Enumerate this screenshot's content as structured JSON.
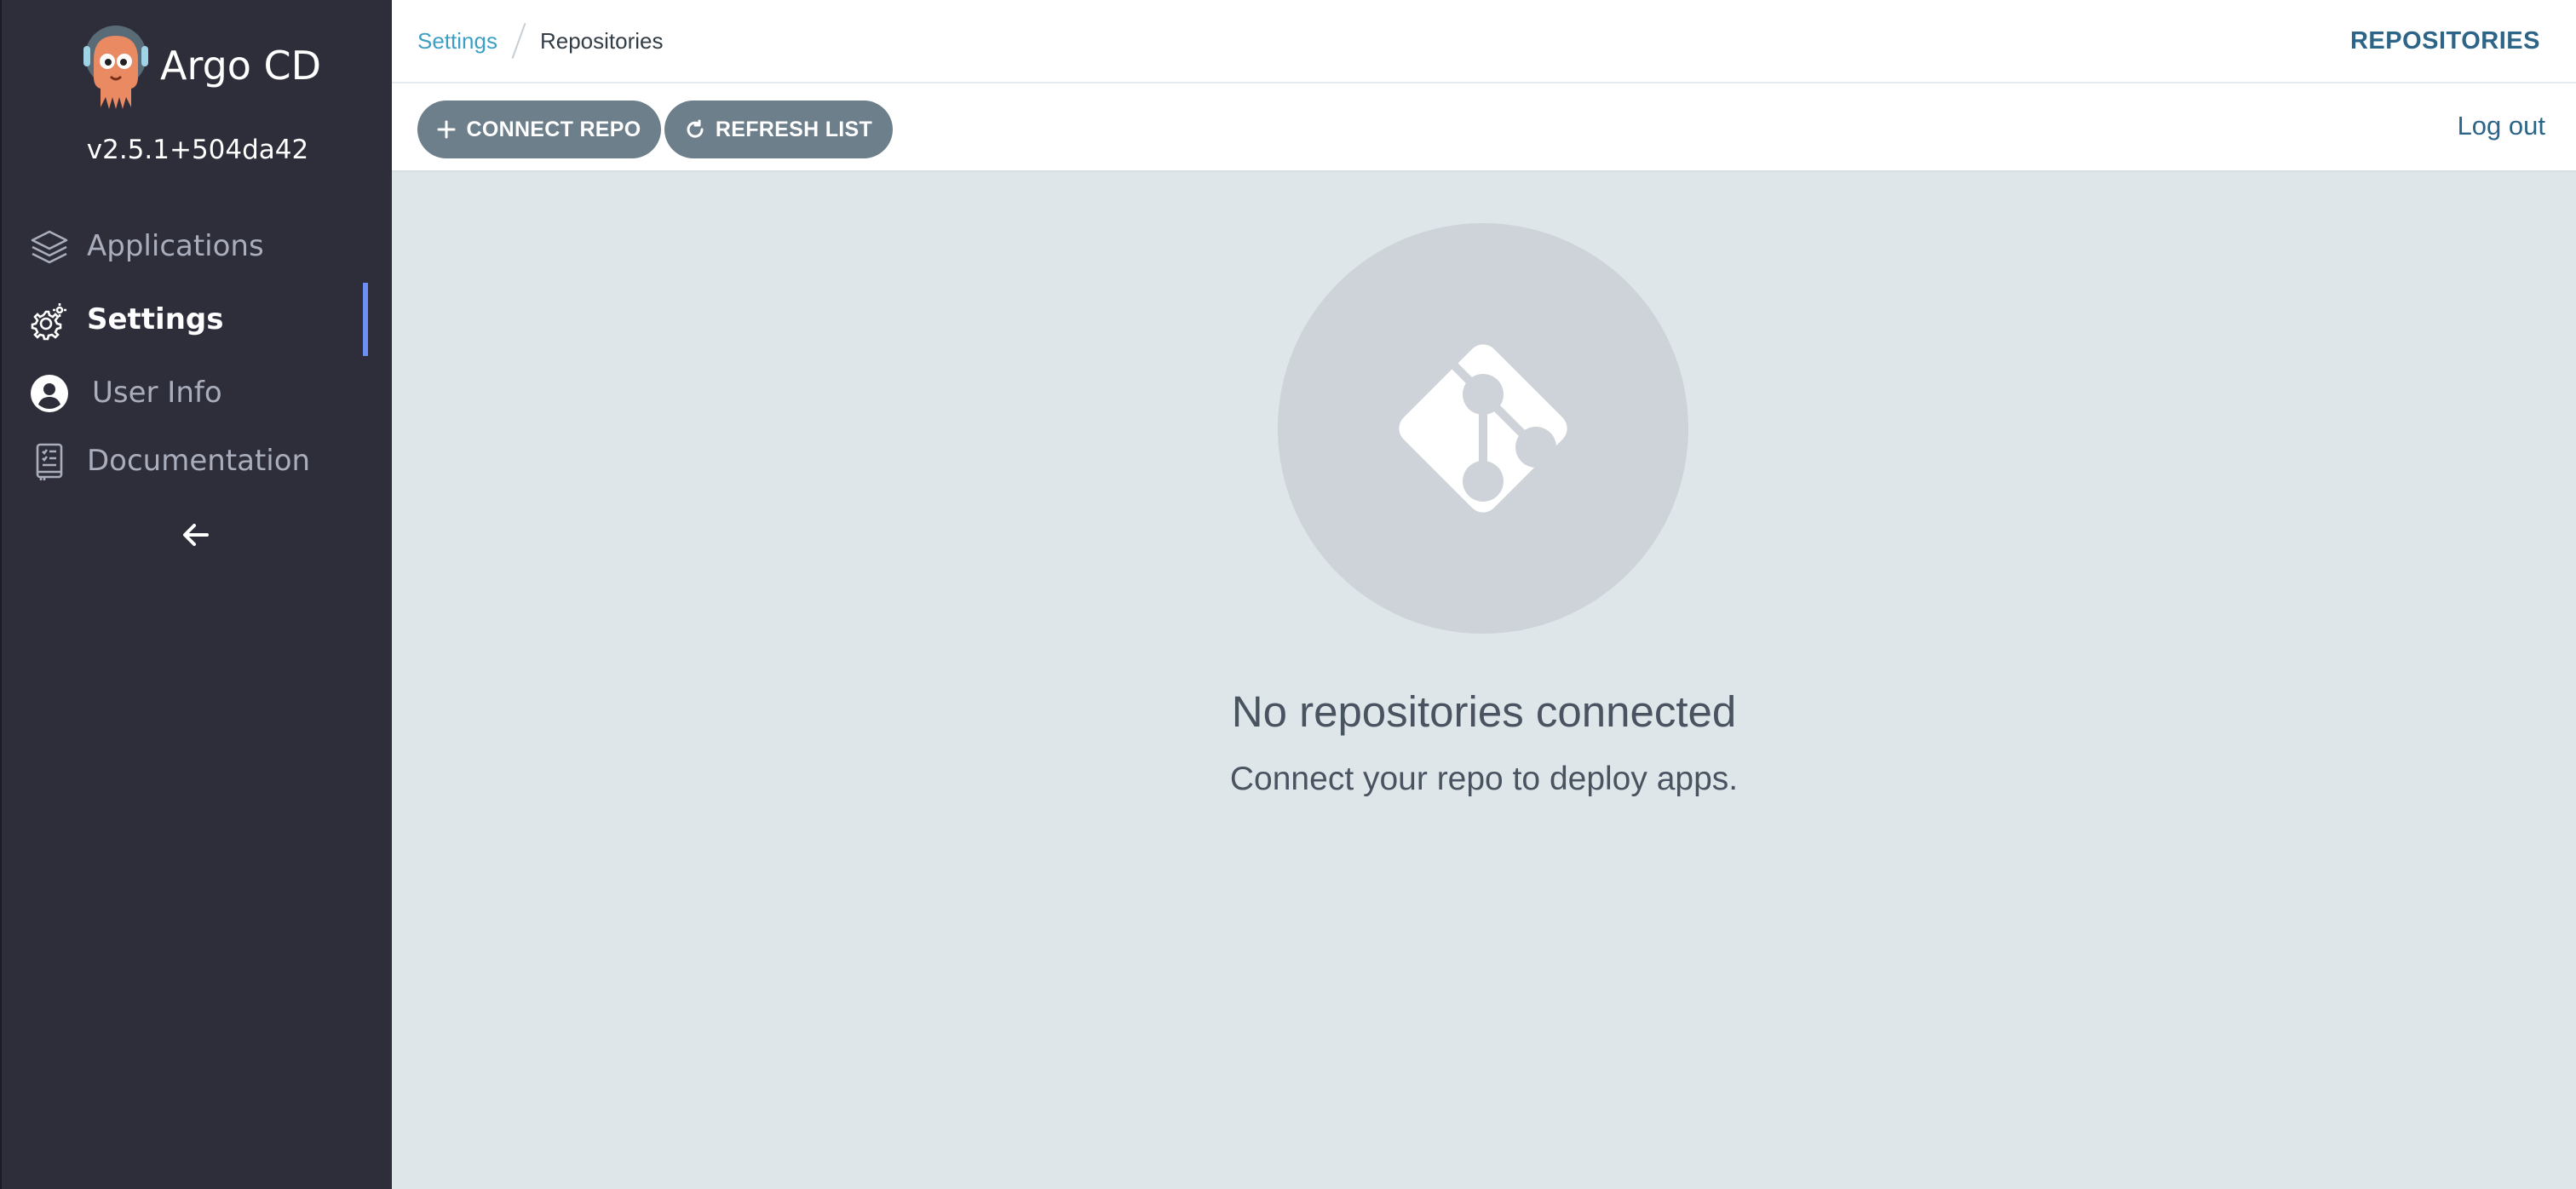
{
  "app": {
    "name": "Argo CD",
    "version": "v2.5.1+504da42"
  },
  "sidebar": {
    "items": [
      {
        "label": "Applications",
        "icon": "layers-icon"
      },
      {
        "label": "Settings",
        "icon": "gear-icon",
        "active": true
      },
      {
        "label": "User Info",
        "icon": "user-circle-icon"
      },
      {
        "label": "Documentation",
        "icon": "book-icon"
      }
    ],
    "collapse_icon": "arrow-left-icon"
  },
  "breadcrumb": {
    "parent": "Settings",
    "current": "Repositories"
  },
  "header": {
    "title": "REPOSITORIES"
  },
  "toolbar": {
    "connect_label": "CONNECT REPO",
    "connect_icon": "plus-icon",
    "refresh_label": "REFRESH LIST",
    "refresh_icon": "refresh-icon",
    "logout_label": "Log out"
  },
  "empty_state": {
    "icon": "git-icon",
    "title": "No repositories connected",
    "subtitle": "Connect your repo to deploy apps."
  },
  "colors": {
    "sidebar_bg": "#2e2e3a",
    "accent": "#6d8ff5",
    "button_bg": "#6d7f8b",
    "link": "#3d9fc4",
    "content_bg": "#dee6ea"
  }
}
